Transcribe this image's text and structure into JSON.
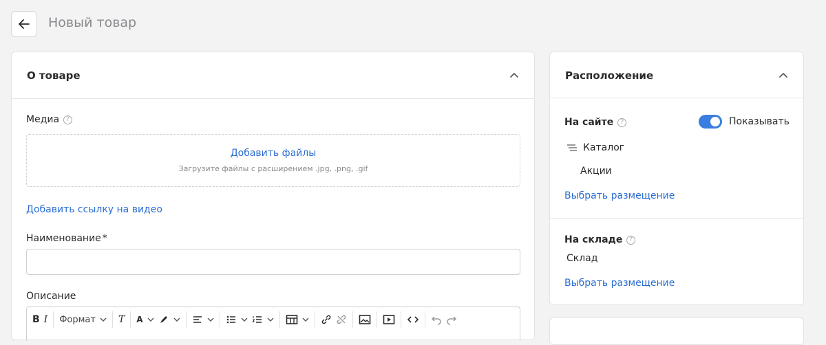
{
  "header": {
    "title": "Новый товар"
  },
  "about": {
    "title": "О товаре",
    "media_label": "Медиа",
    "add_files": "Добавить файлы",
    "files_hint": "Загрузите файлы с расширением .jpg, .png, .gif",
    "add_video_link": "Добавить ссылку на видео",
    "name_label": "Наименование",
    "required_mark": "*",
    "name_value": "",
    "description_label": "Описание",
    "toolbar": {
      "bold": "B",
      "italic": "I",
      "format": "Формат",
      "clear_format": "T",
      "font_color": "A"
    }
  },
  "placement": {
    "title": "Расположение",
    "on_site_label": "На сайте",
    "show_label": "Показывать",
    "show_enabled": true,
    "catalog": "Каталог",
    "promo": "Акции",
    "choose_placement": "Выбрать размещение",
    "warehouse_label": "На складе",
    "warehouse_value": "Склад",
    "choose_placement_2": "Выбрать размещение"
  }
}
